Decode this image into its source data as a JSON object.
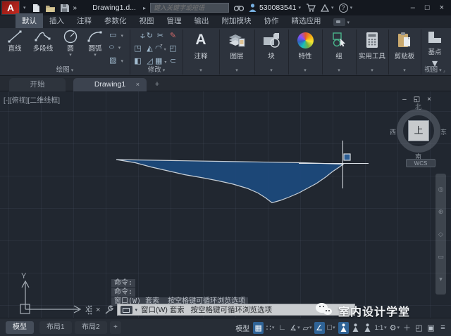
{
  "title_bar": {
    "logo_letter": "A",
    "qat_more": "»",
    "file_name": "Drawing1.d...",
    "expand_arrow": "▸",
    "search_placeholder": "键入关键字或短语",
    "user_id": "530083541",
    "help_glyph": "?",
    "window": {
      "minimize": "–",
      "maximize": "□",
      "close": "×"
    }
  },
  "ribbon": {
    "tabs": [
      {
        "label": "默认",
        "active": true
      },
      {
        "label": "插入"
      },
      {
        "label": "注释"
      },
      {
        "label": "参数化"
      },
      {
        "label": "视图"
      },
      {
        "label": "管理"
      },
      {
        "label": "输出"
      },
      {
        "label": "附加模块"
      },
      {
        "label": "协作"
      },
      {
        "label": "精选应用"
      }
    ],
    "draw_panel": {
      "label": "绘图",
      "tools": [
        {
          "label": "直线"
        },
        {
          "label": "多段线"
        },
        {
          "label": "圆"
        },
        {
          "label": "圆弧"
        }
      ]
    },
    "modify_panel": {
      "label": "修改"
    },
    "big_buttons": [
      {
        "label": "注释"
      },
      {
        "label": "图层"
      },
      {
        "label": "块"
      },
      {
        "label": "特性"
      },
      {
        "label": "组"
      },
      {
        "label": "实用工具"
      },
      {
        "label": "剪贴板"
      },
      {
        "label": "基点"
      }
    ],
    "view_panel_label": "视图"
  },
  "file_tabs": {
    "start": "开始",
    "drawing": "Drawing1",
    "close": "×",
    "new": "+"
  },
  "viewport": {
    "label": "[-][俯视][二维线框]"
  },
  "viewcube": {
    "north": "北",
    "south": "南",
    "west": "西",
    "east": "东",
    "top": "上",
    "wcs": "WCS"
  },
  "ucs": {
    "x": "X",
    "y": "Y"
  },
  "command": {
    "history": [
      "命令:",
      "命令:",
      "窗口(W) 套索  按空格键可循环浏览选项"
    ],
    "prompt": "窗口(W) 套索   按空格键可循环浏览选项"
  },
  "status_bar": {
    "model_tab": "模型",
    "layout1_tab": "布局1",
    "layout2_tab": "布局2",
    "new_layout": "+",
    "model_label": "模型",
    "annotation_scale": "1:1"
  },
  "watermark": {
    "text": "室内设计学堂"
  },
  "colors": {
    "accent_blue": "#2f6396",
    "selection_fill": "#1c4a7e",
    "selection_border": "#c8d0d8",
    "canvas_bg": "#212730"
  }
}
